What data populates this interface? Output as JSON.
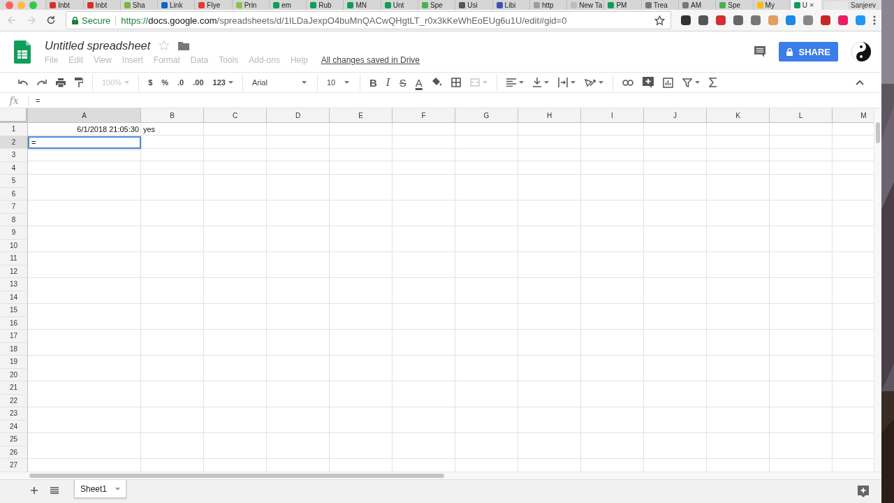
{
  "browser": {
    "tabs": [
      {
        "title": "Inbt",
        "color": "#d93025",
        "selected": false
      },
      {
        "title": "Inbt",
        "color": "#d93025",
        "selected": false
      },
      {
        "title": "Sha",
        "color": "#7cb342",
        "selected": false
      },
      {
        "title": "Link",
        "color": "#0a66c2",
        "selected": false
      },
      {
        "title": "Flye",
        "color": "#e53935",
        "selected": false
      },
      {
        "title": "Prin",
        "color": "#8bc34a",
        "selected": false
      },
      {
        "title": "em",
        "color": "#0f9d58",
        "selected": false
      },
      {
        "title": "Rub",
        "color": "#0f9d58",
        "selected": false
      },
      {
        "title": "MN",
        "color": "#0f9d58",
        "selected": false
      },
      {
        "title": "Unt",
        "color": "#0f9d58",
        "selected": false
      },
      {
        "title": "Spe",
        "color": "#4caf50",
        "selected": false
      },
      {
        "title": "Usi",
        "color": "#555555",
        "selected": false
      },
      {
        "title": "Libi",
        "color": "#3f51b5",
        "selected": false
      },
      {
        "title": "http",
        "color": "#9e9e9e",
        "selected": false
      },
      {
        "title": "New Ta",
        "color": "#bdbdbd",
        "selected": false
      },
      {
        "title": "PM",
        "color": "#0f9d58",
        "selected": false
      },
      {
        "title": "Trea",
        "color": "#777777",
        "selected": false
      },
      {
        "title": "AM",
        "color": "#777777",
        "selected": false
      },
      {
        "title": "Spe",
        "color": "#4caf50",
        "selected": false
      },
      {
        "title": "My",
        "color": "#fbbc04",
        "selected": false
      },
      {
        "title": "U",
        "color": "#0f9d58",
        "selected": true
      }
    ],
    "close_tab": "×",
    "profile": "Sanjeev",
    "secure": "Secure",
    "url": {
      "scheme": "https://",
      "host": "docs.google.com",
      "path": "/spreadsheets/d/1ILDaJexpO4buMnQACwQHgtLT_r0x3kKeWhEoEUg6u1U/edit#gid=0"
    },
    "extensions": [
      {
        "color": "#333333"
      },
      {
        "color": "#555555"
      },
      {
        "color": "#d32f2f"
      },
      {
        "color": "#666666"
      },
      {
        "color": "#777777"
      },
      {
        "color": "#e0a060"
      },
      {
        "color": "#1e88e5"
      },
      {
        "color": "#888888"
      },
      {
        "color": "#c62828"
      },
      {
        "color": "#e91e63"
      },
      {
        "color": "#2196f3"
      }
    ]
  },
  "document": {
    "title": "Untitled spreadsheet",
    "starred": false,
    "menu": [
      {
        "label": "File",
        "disabled": true
      },
      {
        "label": "Edit",
        "disabled": true
      },
      {
        "label": "View",
        "disabled": true
      },
      {
        "label": "Insert",
        "disabled": true
      },
      {
        "label": "Format",
        "disabled": true
      },
      {
        "label": "Data",
        "disabled": true
      },
      {
        "label": "Tools",
        "disabled": true
      },
      {
        "label": "Add-ons",
        "disabled": true
      },
      {
        "label": "Help",
        "disabled": true
      }
    ],
    "save_status": "All changes saved in Drive",
    "share": "SHARE"
  },
  "toolbar": {
    "zoom": {
      "label": "100%",
      "disabled": true
    },
    "currency": "$",
    "percent": "%",
    "decrease_decimals": ".0",
    "increase_decimals": ".00",
    "more_formats": "123",
    "font": "Arial",
    "font_size": "10",
    "bold": "B",
    "italic": "I",
    "strikethrough": "S",
    "text_color": "A",
    "merge_disabled": true
  },
  "formula_bar": {
    "label": "fx",
    "value": "="
  },
  "sheet": {
    "columns": [
      {
        "label": "A",
        "selected": true
      },
      {
        "label": "B",
        "selected": false
      },
      {
        "label": "C",
        "selected": false
      },
      {
        "label": "D",
        "selected": false
      },
      {
        "label": "E",
        "selected": false
      },
      {
        "label": "F",
        "selected": false
      },
      {
        "label": "G",
        "selected": false
      },
      {
        "label": "H",
        "selected": false
      },
      {
        "label": "I",
        "selected": false
      },
      {
        "label": "J",
        "selected": false
      },
      {
        "label": "K",
        "selected": false
      },
      {
        "label": "L",
        "selected": false
      },
      {
        "label": "M",
        "selected": false
      }
    ],
    "rows": [
      {
        "label": "1",
        "selected": false,
        "cells": [
          {
            "text": "6/1/2018 21:05:30",
            "kind": "number"
          },
          {
            "text": "yes",
            "kind": "text"
          }
        ]
      },
      {
        "label": "2",
        "selected": true,
        "editor": "="
      },
      {
        "label": "3",
        "selected": false
      },
      {
        "label": "4",
        "selected": false
      },
      {
        "label": "5",
        "selected": false
      },
      {
        "label": "6",
        "selected": false
      },
      {
        "label": "7",
        "selected": false
      },
      {
        "label": "8",
        "selected": false
      },
      {
        "label": "9",
        "selected": false
      },
      {
        "label": "10",
        "selected": false
      },
      {
        "label": "11",
        "selected": false
      },
      {
        "label": "12",
        "selected": false
      },
      {
        "label": "13",
        "selected": false
      },
      {
        "label": "14",
        "selected": false
      },
      {
        "label": "15",
        "selected": false
      },
      {
        "label": "16",
        "selected": false
      },
      {
        "label": "17",
        "selected": false
      },
      {
        "label": "18",
        "selected": false
      },
      {
        "label": "19",
        "selected": false
      },
      {
        "label": "20",
        "selected": false
      },
      {
        "label": "21",
        "selected": false
      },
      {
        "label": "22",
        "selected": false
      },
      {
        "label": "23",
        "selected": false
      },
      {
        "label": "24",
        "selected": false
      },
      {
        "label": "25",
        "selected": false
      },
      {
        "label": "26",
        "selected": false
      },
      {
        "label": "27",
        "selected": false
      }
    ]
  },
  "sheet_tabs": [
    {
      "label": "Sheet1",
      "selected": true
    }
  ]
}
